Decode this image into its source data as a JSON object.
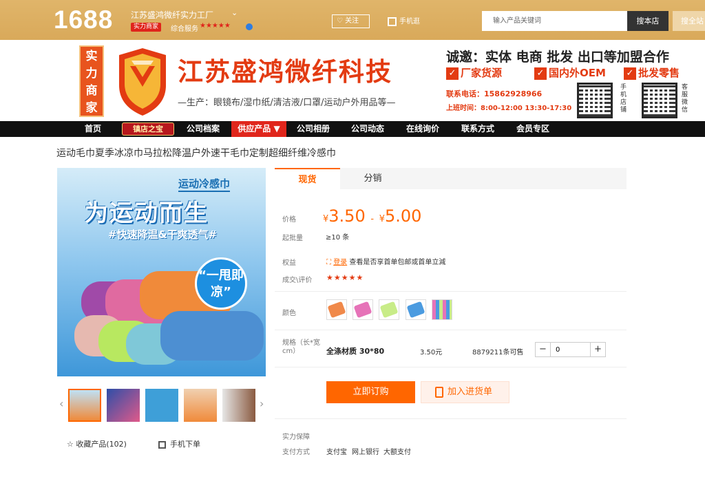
{
  "topbar": {
    "logo": "1688",
    "shop_name": "江苏盛鸿微纤实力工厂",
    "badge": "实力商家",
    "service_label": "综合服务",
    "service_stars": "★★★★★",
    "follow": "关注",
    "mobile": "手机逛",
    "search_placeholder": "输入产品关键词",
    "search_store": "搜本店",
    "search_all": "搜全站"
  },
  "banner": {
    "badge_text": "实力商家",
    "company_name": "江苏盛鸿微纤科技",
    "products_line": "—生产：眼镜布/湿巾纸/清洁液/口罩/运动户外用品等—",
    "invite": "诚邀：实体 电商 批发 出口等加盟合作",
    "checks": [
      "厂家货源",
      "国内外OEM",
      "批发零售"
    ],
    "phone": "联系电话：15862928966",
    "hours": "上班时间：8:00-12:00  13:30-17:30",
    "qr_labels": [
      "手机店铺",
      "客服微信"
    ]
  },
  "nav": {
    "items": [
      "首页",
      "镇店之宝",
      "公司档案",
      "供应产品 ▼",
      "公司相册",
      "公司动态",
      "在线询价",
      "联系方式",
      "会员专区"
    ]
  },
  "product": {
    "title": "运动毛巾夏季冰凉巾马拉松降温户外速干毛巾定制超细纤维冷感巾",
    "image_tag": "运动冷感巾",
    "image_headline": "为运动而生",
    "image_sub": "#快速降温&干爽透气#",
    "image_bubble": "“一甩即凉”",
    "favorite": "☆  收藏产品(102)",
    "mobile_order": "手机下单"
  },
  "tabs": [
    "现货",
    "分销"
  ],
  "details": {
    "price_label": "价格",
    "price_low": "3.50",
    "price_high": "5.00",
    "currency": "¥",
    "price_sep": "-",
    "moq_label": "起批量",
    "moq": "≥10 条",
    "rights_label": "权益",
    "rights_link": "登录",
    "rights_text": "查看是否享首单包邮或首单立減",
    "rating_label": "成交\\评价",
    "rating_stars": "★★★★★",
    "color_label": "颜色",
    "spec_label": "规格（长*宽cm）",
    "spec_name": "全涤材质 30*80",
    "spec_price": "3.50元",
    "spec_stock": "8879211条可售",
    "qty_minus": "−",
    "qty_value": "0",
    "qty_plus": "+",
    "buy_now": "立即订购",
    "add_cart": "加入进货单",
    "guarantee_label": "实力保障",
    "pay_label": "支付方式",
    "pay_methods": [
      "支付宝",
      "网上银行",
      "大额支付"
    ]
  },
  "colors": {
    "accent": "#ff6600",
    "topbar": "#d9a95a",
    "nav": "#111111",
    "nav_active": "#e0261c"
  }
}
